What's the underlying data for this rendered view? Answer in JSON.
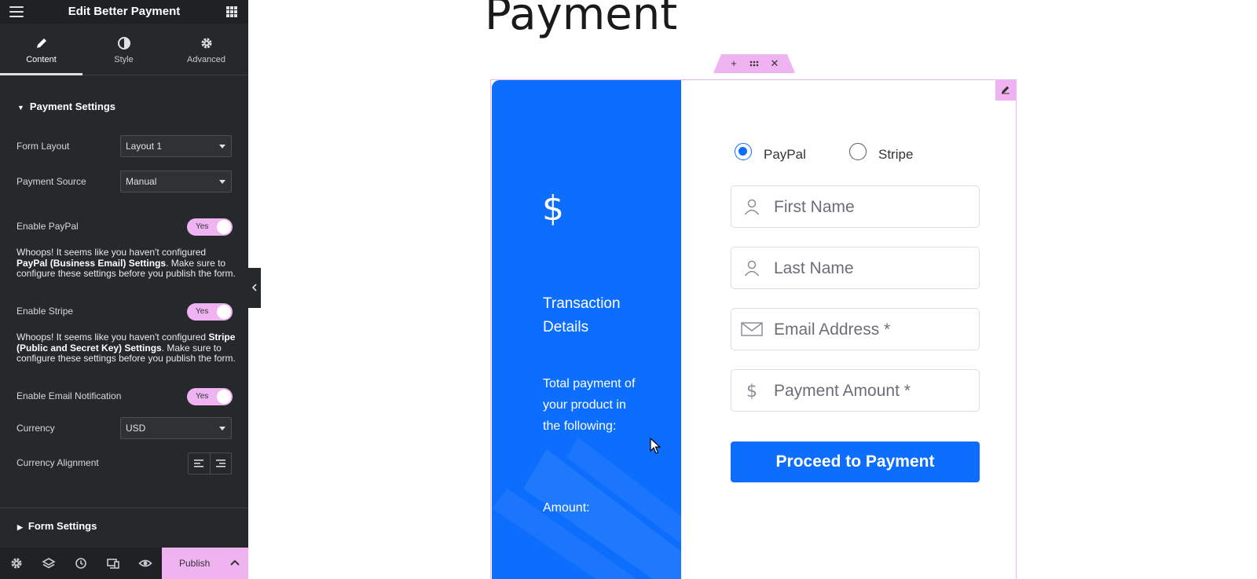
{
  "editor": {
    "title": "Edit Better Payment",
    "tabs": [
      {
        "label": "Content",
        "icon": "pencil-icon"
      },
      {
        "label": "Style",
        "icon": "contrast-icon"
      },
      {
        "label": "Advanced",
        "icon": "gear-icon"
      }
    ],
    "section_payment": "Payment Settings",
    "form_layout": {
      "label": "Form Layout",
      "value": "Layout 1"
    },
    "payment_source": {
      "label": "Payment Source",
      "value": "Manual"
    },
    "enable_paypal": {
      "label": "Enable PayPal",
      "toggle": "Yes"
    },
    "paypal_notice": {
      "part1": "Whoops! It seems like you haven't configured ",
      "bold": "PayPal (Business Email) Settings",
      "part2": ". Make sure to configure these settings before you publish the form."
    },
    "enable_stripe": {
      "label": "Enable Stripe",
      "toggle": "Yes"
    },
    "stripe_notice": {
      "part1": "Whoops! It seems like you haven't configured ",
      "bold": "Stripe (Public and Secret Key) Settings",
      "part2": ". Make sure to configure these settings before you publish the form."
    },
    "enable_email": {
      "label": "Enable Email Notification",
      "toggle": "Yes"
    },
    "currency": {
      "label": "Currency",
      "value": "USD"
    },
    "currency_alignment": {
      "label": "Currency Alignment"
    },
    "section_form": "Form Settings",
    "footer": {
      "publish": "Publish"
    }
  },
  "canvas": {
    "heading": "Payment",
    "left_panel": {
      "symbol": "$",
      "title": "Transaction Details",
      "description": "Total payment of your product in the following:",
      "amount_label": "Amount:"
    },
    "methods": [
      {
        "label": "PayPal",
        "checked": true
      },
      {
        "label": "Stripe",
        "checked": false
      }
    ],
    "fields": {
      "first_name": "First Name",
      "last_name": "Last Name",
      "email": "Email Address *",
      "amount": "Payment Amount *"
    },
    "submit": "Proceed to Payment"
  },
  "colors": {
    "primary": "#0d6efd",
    "accent_pink": "#f0b3f2",
    "panel_dark": "#26292c"
  }
}
